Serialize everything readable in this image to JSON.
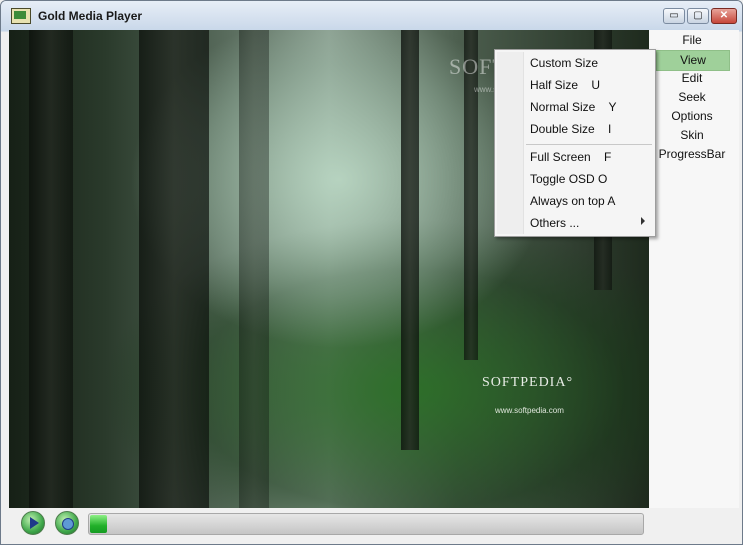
{
  "window": {
    "title": "Gold Media Player",
    "controls": {
      "minimize": "▭",
      "maximize": "▢",
      "close": "✕"
    }
  },
  "video": {
    "watermark_top": "SOFTPEDIA",
    "watermark_top_url": "www.softpedia.com",
    "watermark_logo": "SOFTPEDIA°",
    "watermark_url": "www.softpedia.com"
  },
  "side_menu": {
    "items": [
      {
        "label": "File"
      },
      {
        "label": "View"
      },
      {
        "label": "Edit"
      },
      {
        "label": "Seek"
      },
      {
        "label": "Options"
      },
      {
        "label": "Skin"
      },
      {
        "label": "ProgressBar"
      }
    ],
    "active": "View"
  },
  "context_menu": {
    "items": [
      {
        "label": "Custom Size"
      },
      {
        "label": "Half Size    U"
      },
      {
        "label": "Normal Size    Y"
      },
      {
        "label": "Double Size    I"
      },
      {
        "label": "Full Screen    F"
      },
      {
        "label": "Toggle OSD O"
      },
      {
        "label": "Always on top A"
      },
      {
        "label": "Others ..."
      }
    ]
  },
  "controls": {
    "play_icon": "play-icon",
    "stop_icon": "stop-icon",
    "progress": 0.03
  },
  "colors": {
    "accent_green": "#9fd09a",
    "progress_green": "#22b02a"
  }
}
